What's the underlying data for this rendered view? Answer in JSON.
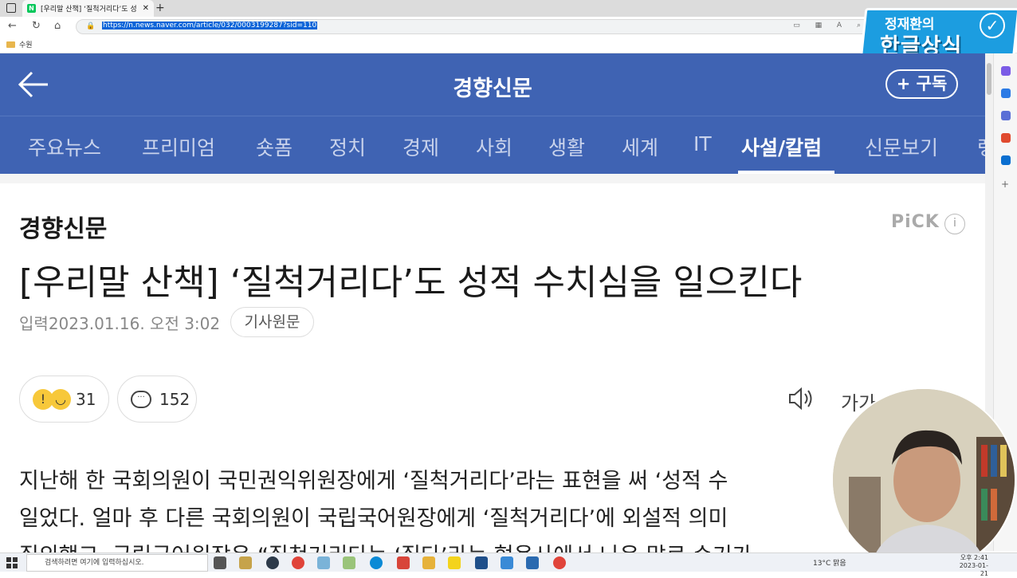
{
  "browser": {
    "tab_title": "[우리말 산책] ‘질척거리다’도 성적 수치심을 일으킨다",
    "tab_favicon": "N",
    "tab_close": "✕",
    "new_tab": "+",
    "url": "https://n.news.naver.com/article/032/0003199287?sid=110",
    "bookmark": "수원"
  },
  "overlay": {
    "line1": "정재환의",
    "line2": "한글상식",
    "check": "✓"
  },
  "header": {
    "title": "경향신문",
    "subscribe": "+ 구독"
  },
  "menu": {
    "items": [
      "주요뉴스",
      "프리미엄",
      "숏폼",
      "정치",
      "경제",
      "사회",
      "생활",
      "세계",
      "IT",
      "사설/칼럼",
      "신문보기",
      "랭"
    ],
    "active_index": 9
  },
  "article": {
    "press": "경향신문",
    "pick": "PiCK",
    "pick_info": "i",
    "headline": "[우리말 산책] ‘질척거리다’도 성적 수치심을 일으킨다",
    "date_label": "입력",
    "date": "2023.01.16. 오전 3:02",
    "original_link": "기사원문",
    "reaction_count": "31",
    "comment_count": "152",
    "font_size_label": "가가",
    "body_lines": [
      "지난해 한 국회의원이 국민권익위원장에게 ‘질척거리다’라는 표현을 써 ‘성적 수",
      "일었다. 얼마 후 다른 국회의원이 국립국어원장에게 ‘질척거리다’에 외설적 의미",
      "질의했고, 국립국어원장은 “질척거리다는 ‘질다’라는 형용사에서 나온 말로 순기가"
    ]
  },
  "taskbar": {
    "search_placeholder": "검색하려면 여기에 입력하십시오.",
    "weather": "13°C 맑음",
    "time": "오후 2:41",
    "date": "2023-01-21"
  }
}
